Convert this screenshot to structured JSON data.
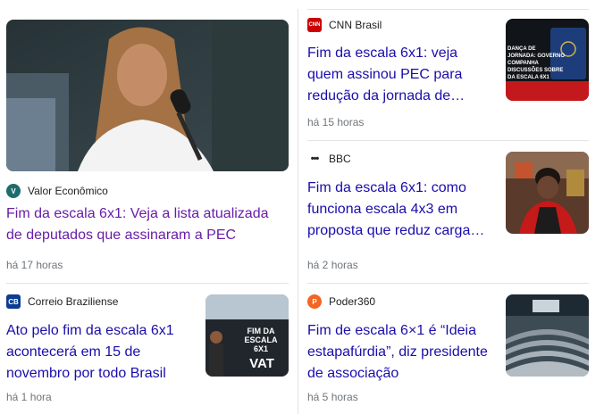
{
  "cards": [
    {
      "source": "Valor Econômico",
      "logo_text": "V",
      "logo_color": "#1e6c6c",
      "title": "Fim da escala 6x1: Veja a lista atualizada de deputados que assinaram a PEC",
      "time": "há 17 horas",
      "visited": true
    },
    {
      "source": "CNN Brasil",
      "logo_text": "CNN",
      "logo_color": "#cc0000",
      "title": "Fim da escala 6x1: veja quem assinou PEC para redução da jornada de…",
      "time": "há 15 horas",
      "thumb_text": "DANÇA DE\nJORNADA: GOVERNO\nCOMPANHA\nDISCUSSÕES SOBRE\nDA ESCALA 6X1"
    },
    {
      "source": "BBC",
      "logo_text": "•••",
      "logo_color": "#202124",
      "title": "Fim da escala 6x1: como funciona escala 4x3 em proposta que reduz carga…",
      "time": "há 2 horas"
    },
    {
      "source": "Correio Braziliense",
      "logo_text": "CB",
      "logo_color": "#0b3d91",
      "title": "Ato pelo fim da escala 6x1 acontecerá em 15 de novembro por todo Brasil",
      "time": "há 1 hora",
      "thumb_text": "FIM DA\nESCALA\n6X1",
      "thumb_text2": "VAT"
    },
    {
      "source": "Poder360",
      "logo_text": "P",
      "logo_color": "#f26522",
      "title": "Fim de escala 6×1 é “Ideia estapafúrdia”, diz presidente de associação",
      "time": "há 5 horas"
    }
  ]
}
